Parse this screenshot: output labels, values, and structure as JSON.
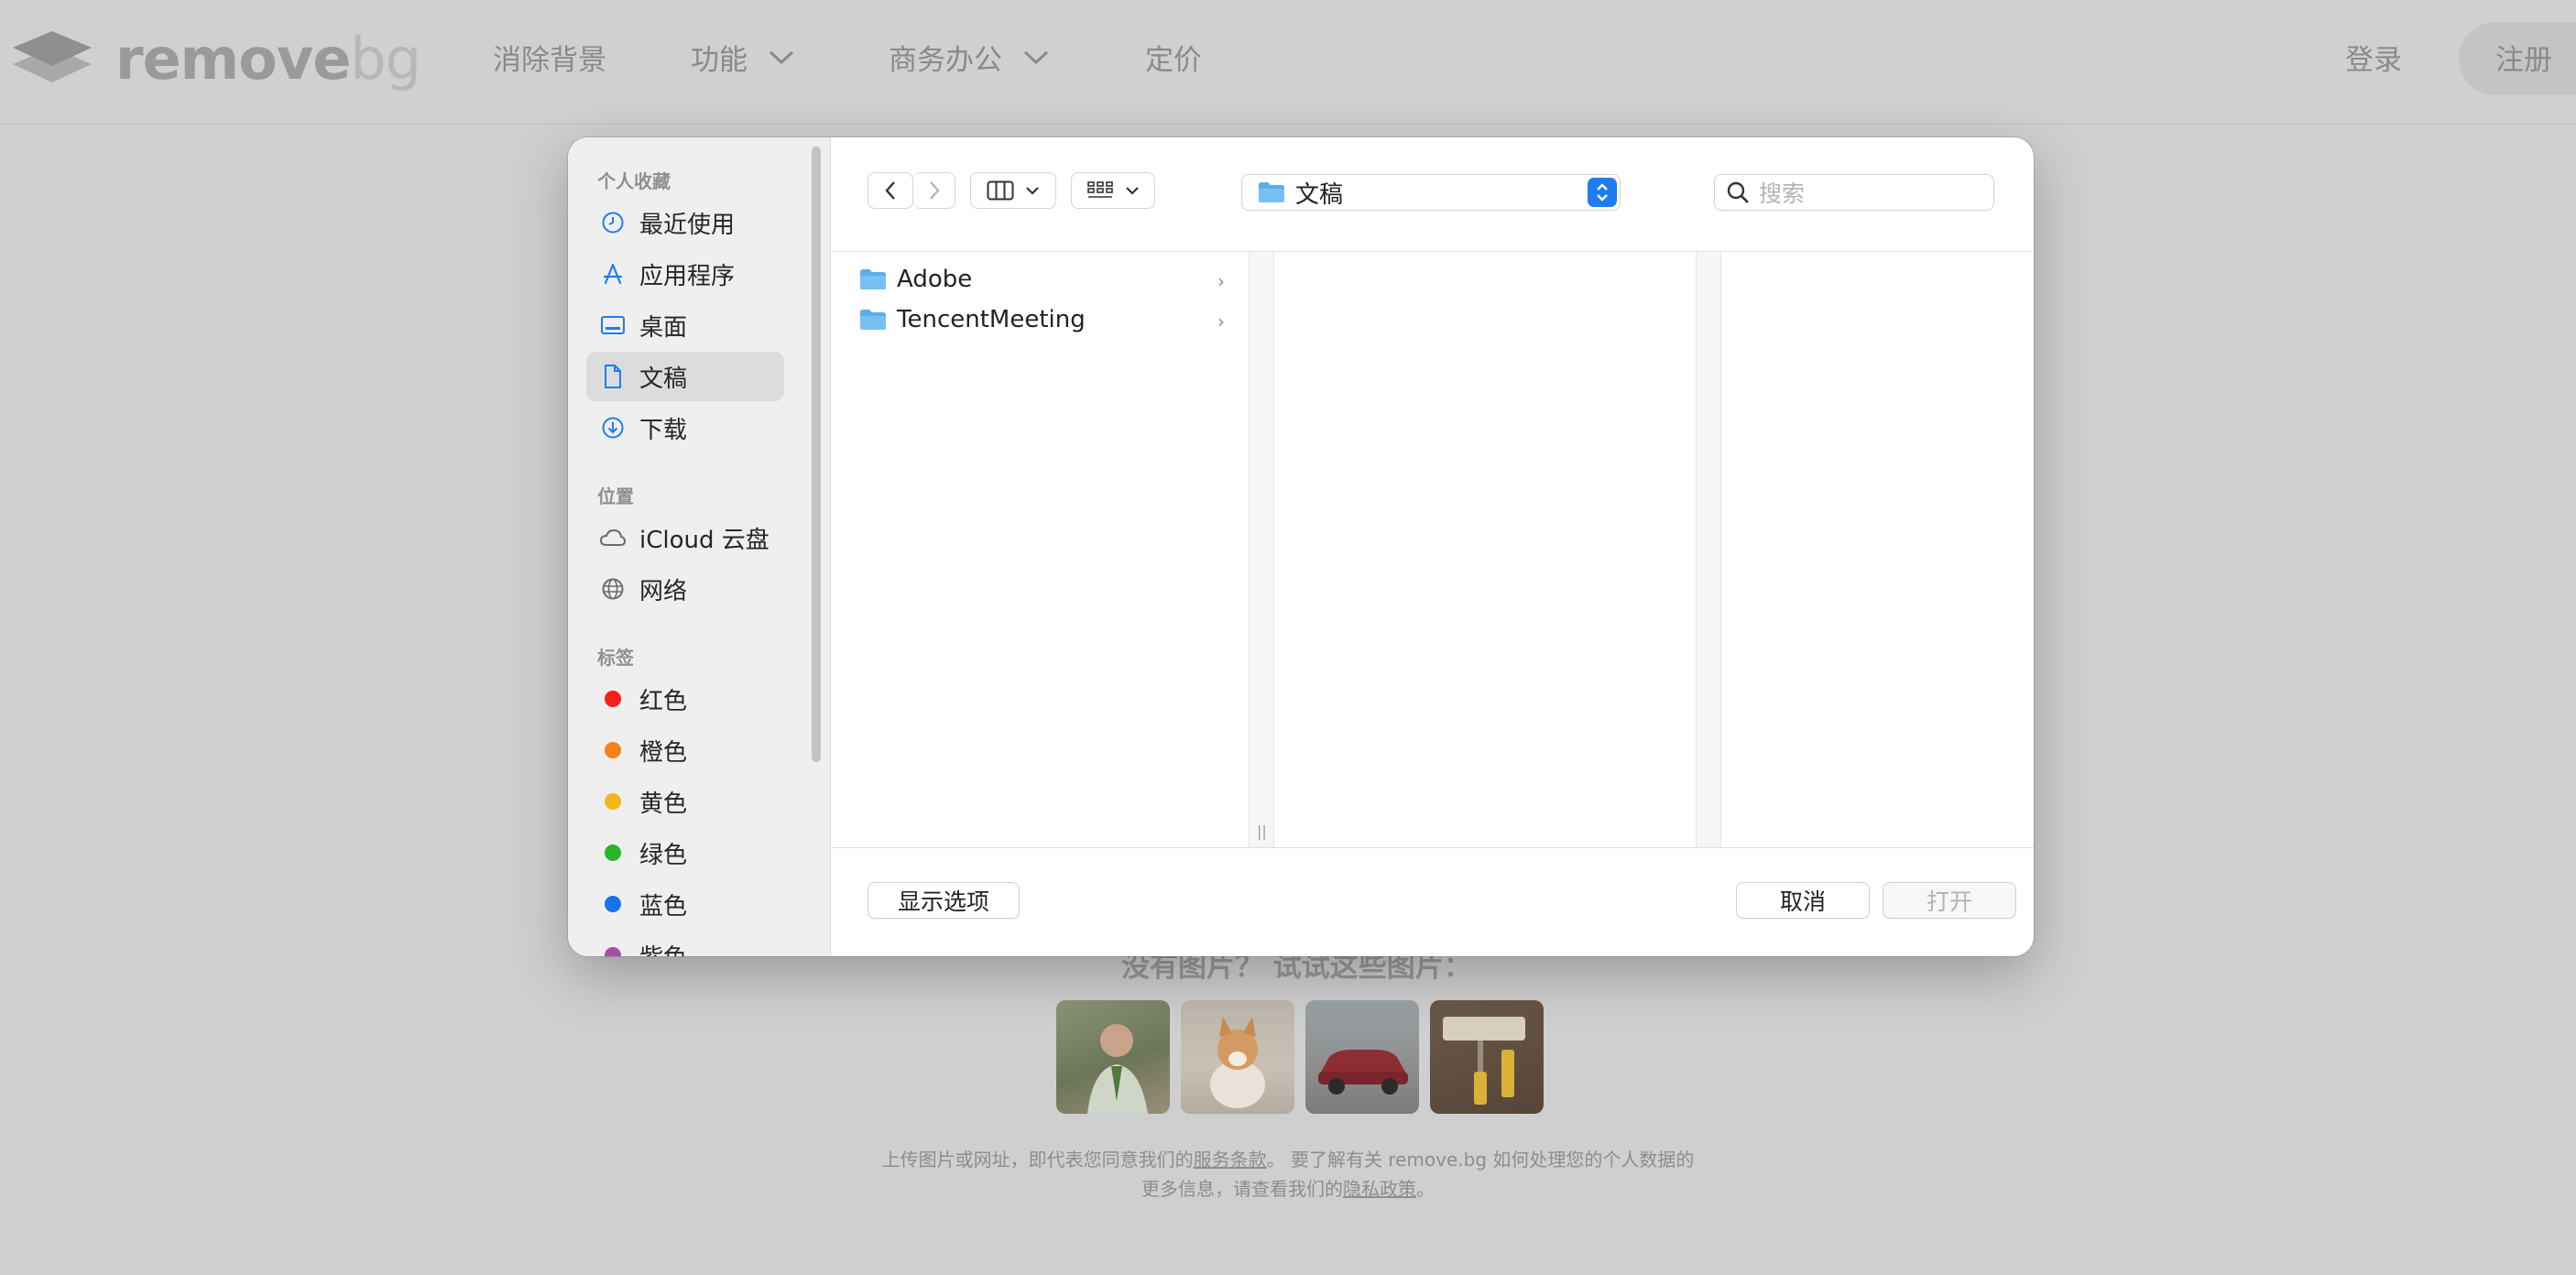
{
  "site": {
    "logo_main": "remove",
    "logo_bg": "bg",
    "nav": [
      "消除背景",
      "功能",
      "商务办公",
      "定价"
    ],
    "login": "登录",
    "signup": "注册",
    "try_text": "没有图片？ 试试这些图片：",
    "footer_line1_a": "上传图片或网址，即代表您同意我们的",
    "footer_terms": "服务条款",
    "footer_line1_b": "。 要了解有关 remove.bg 如何处理您的个人数据的",
    "footer_line2_a": "更多信息，请查看我们的",
    "footer_privacy": "隐私政策",
    "footer_line2_b": "。"
  },
  "dialog": {
    "sidebar": {
      "favorites_title": "个人收藏",
      "favorites": [
        "最近使用",
        "应用程序",
        "桌面",
        "文稿",
        "下载"
      ],
      "locations_title": "位置",
      "locations": [
        "iCloud 云盘",
        "网络"
      ],
      "tags_title": "标签",
      "tags": [
        {
          "label": "红色",
          "color": "#f5201b"
        },
        {
          "label": "橙色",
          "color": "#f7821b"
        },
        {
          "label": "黄色",
          "color": "#f5b619"
        },
        {
          "label": "绿色",
          "color": "#2ab52c"
        },
        {
          "label": "蓝色",
          "color": "#1a73ea"
        },
        {
          "label": "紫色",
          "color": "#a550a7"
        }
      ]
    },
    "toolbar": {
      "current_folder": "文稿",
      "search_placeholder": "搜索"
    },
    "files": [
      "Adobe",
      "TencentMeeting"
    ],
    "buttons": {
      "options": "显示选项",
      "cancel": "取消",
      "open": "打开"
    },
    "accent_color": "#1e7cf3"
  }
}
